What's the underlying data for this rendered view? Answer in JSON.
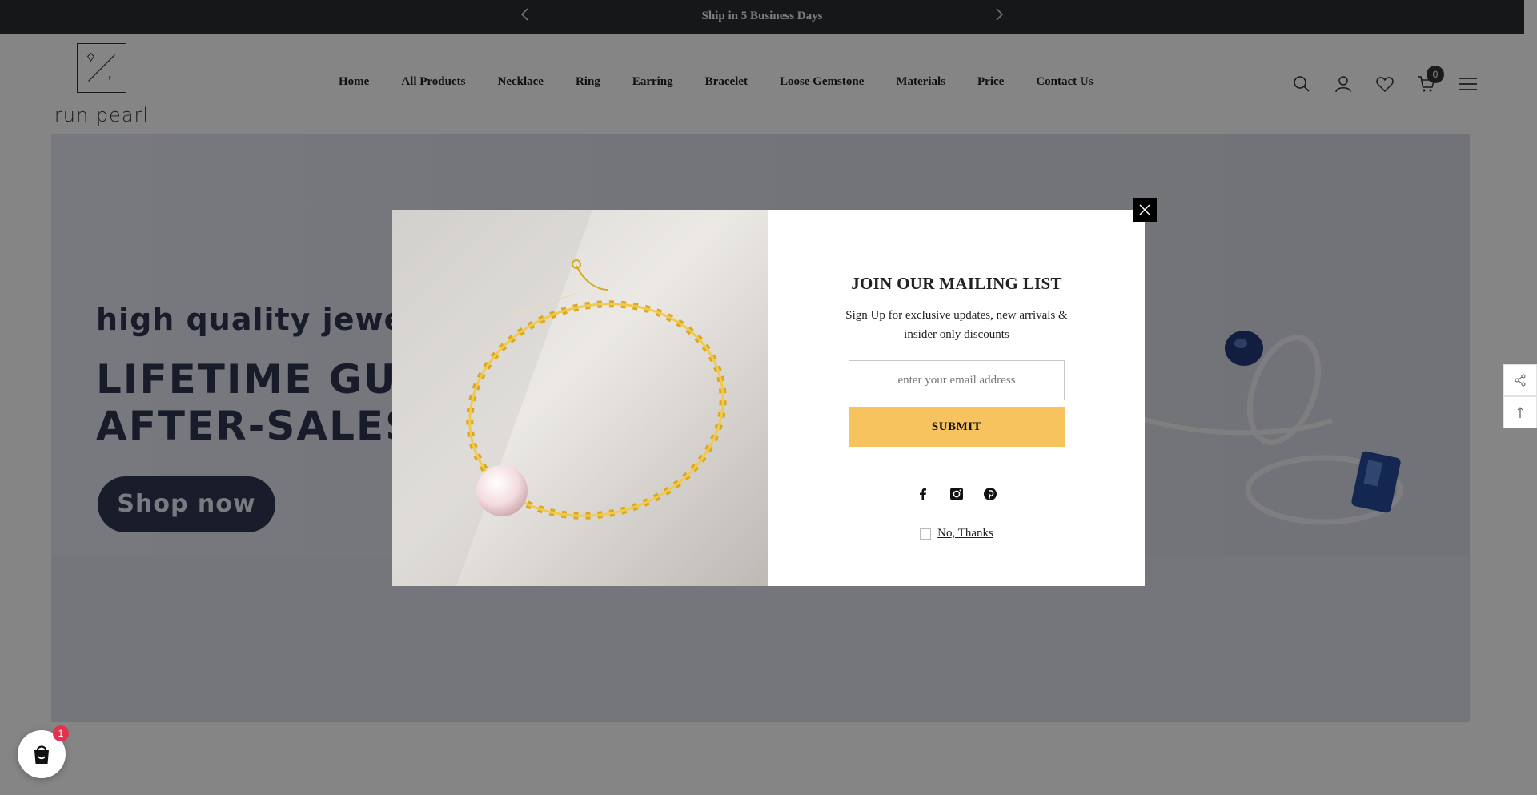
{
  "announcement": {
    "message": "Ship in 5 Business Days"
  },
  "brand": {
    "name": "run pearl"
  },
  "nav": {
    "items": [
      "Home",
      "All Products",
      "Necklace",
      "Ring",
      "Earring",
      "Bracelet",
      "Loose Gemstone",
      "Materials",
      "Price",
      "Contact Us"
    ]
  },
  "header_icons": {
    "cart_count": "0"
  },
  "hero": {
    "line1": "high quality jewel",
    "line2a": "LIFETIME GUAI",
    "line2b": "AFTER-SALES",
    "button": "Shop now"
  },
  "popup": {
    "title": "JOIN OUR MAILING LIST",
    "subtitle": "Sign Up for exclusive updates, new arrivals & insider only discounts",
    "email_placeholder": "enter your email address",
    "submit_label": "SUBMIT",
    "no_thanks": "No, Thanks",
    "social": [
      "facebook-icon",
      "instagram-icon",
      "pinterest-icon"
    ]
  },
  "chat": {
    "badge": "1"
  },
  "colors": {
    "announcement_bg": "#2b2d2f",
    "submit_bg": "#f7c35f",
    "hero_text": "#2f3551",
    "chat_badge": "#e2324f"
  }
}
